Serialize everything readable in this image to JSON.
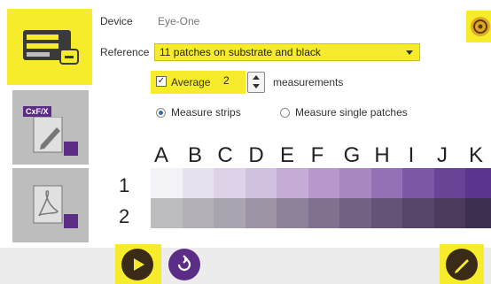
{
  "colors": {
    "highlight": "#f6ec2c",
    "purple": "#5b2d86",
    "sidebar_gray": "#bdbdbd",
    "button_dark": "#3a2a18"
  },
  "sidebar": {
    "items": [
      {
        "name": "measure-device",
        "icon": "measure-device-icon",
        "active": true
      },
      {
        "name": "cxf-edit",
        "icon": "cxf-edit-icon",
        "badge": "CxF/X"
      },
      {
        "name": "pdf-export",
        "icon": "pdf-icon"
      }
    ]
  },
  "form": {
    "device_label": "Device",
    "device_value": "Eye-One",
    "reference_label": "Reference",
    "reference_value": "11 patches on substrate and black",
    "average_label": "Average",
    "average_checked": true,
    "average_value": "2",
    "measurements_label": "measurements",
    "strips_label": "Measure strips",
    "single_label": "Measure single patches",
    "selected_mode": "strips"
  },
  "grid": {
    "columns": [
      "A",
      "B",
      "C",
      "D",
      "E",
      "F",
      "G",
      "H",
      "I",
      "J",
      "K"
    ],
    "rows": [
      "1",
      "2"
    ],
    "row1_colors": [
      "#f3f2f7",
      "#e8e2ef",
      "#ddd2e8",
      "#d1c1e1",
      "#c4acd6",
      "#b897cd",
      "#a985c1",
      "#9670b5",
      "#7d58a6",
      "#6a4397",
      "#5b3590"
    ],
    "row2_colors": [
      "#bdbcbf",
      "#b4b0b8",
      "#aaa3b0",
      "#9d94a6",
      "#8e829b",
      "#7f718f",
      "#716283",
      "#645376",
      "#574569",
      "#4a3a5c",
      "#3d2f4f"
    ]
  },
  "toolbar": {
    "play_icon": "play-icon",
    "reset_icon": "reset-icon",
    "edit_icon": "pencil-icon",
    "settings_icon": "gear-icon"
  }
}
